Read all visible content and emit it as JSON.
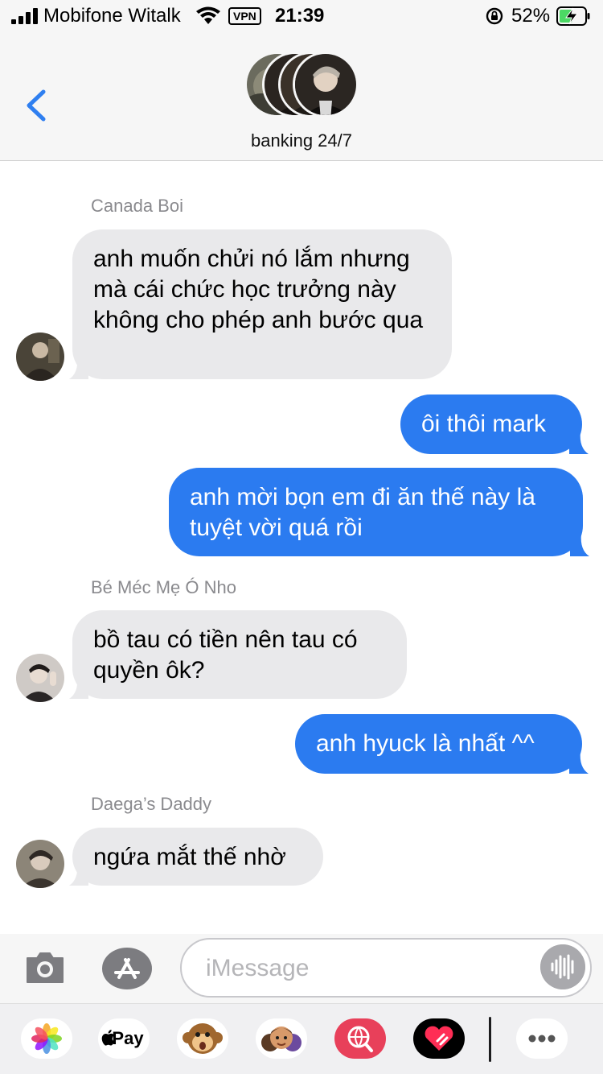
{
  "status_bar": {
    "carrier": "Mobifone Witalk",
    "vpn": "VPN",
    "time": "21:39",
    "battery_percent": "52%",
    "battery_level": 0.52,
    "icons": [
      "signal-icon",
      "wifi-icon",
      "vpn-badge",
      "orientation-lock-icon",
      "battery-charging-icon"
    ]
  },
  "header": {
    "group_name": "banking 24/7",
    "back_icon": "chevron-left-icon"
  },
  "messages": [
    {
      "direction": "incoming",
      "sender": "Canada Boi",
      "text": "anh muốn chửi nó lắm nhưng mà cái chức học trưởng này không cho phép anh bước qua"
    },
    {
      "direction": "outgoing",
      "text": "ôi thôi mark"
    },
    {
      "direction": "outgoing",
      "text": "anh mời bọn em đi ăn thế này là tuyệt vời quá rồi"
    },
    {
      "direction": "incoming",
      "sender": "Bé Méc Mẹ Ó Nho",
      "text": "bồ tau có tiền nên tau có quyền ôk?"
    },
    {
      "direction": "outgoing",
      "text": "anh hyuck là nhất ^^"
    },
    {
      "direction": "incoming",
      "sender": "Daega’s Daddy",
      "text": "ngứa mắt thế nhờ"
    }
  ],
  "input_bar": {
    "placeholder": "iMessage",
    "icons": [
      "camera-icon",
      "app-store-icon",
      "audio-waveform-icon"
    ]
  },
  "app_drawer": {
    "apple_pay_label": "Pay",
    "apps": [
      "photos-icon",
      "apple-pay-icon",
      "animoji-monkey-icon",
      "memoji-icon",
      "web-search-icon",
      "digital-touch-icon",
      "more-icon"
    ]
  },
  "colors": {
    "outgoing_bubble": "#2b7bf0",
    "incoming_bubble": "#e9e9eb",
    "accent": "#2f7ff0"
  }
}
